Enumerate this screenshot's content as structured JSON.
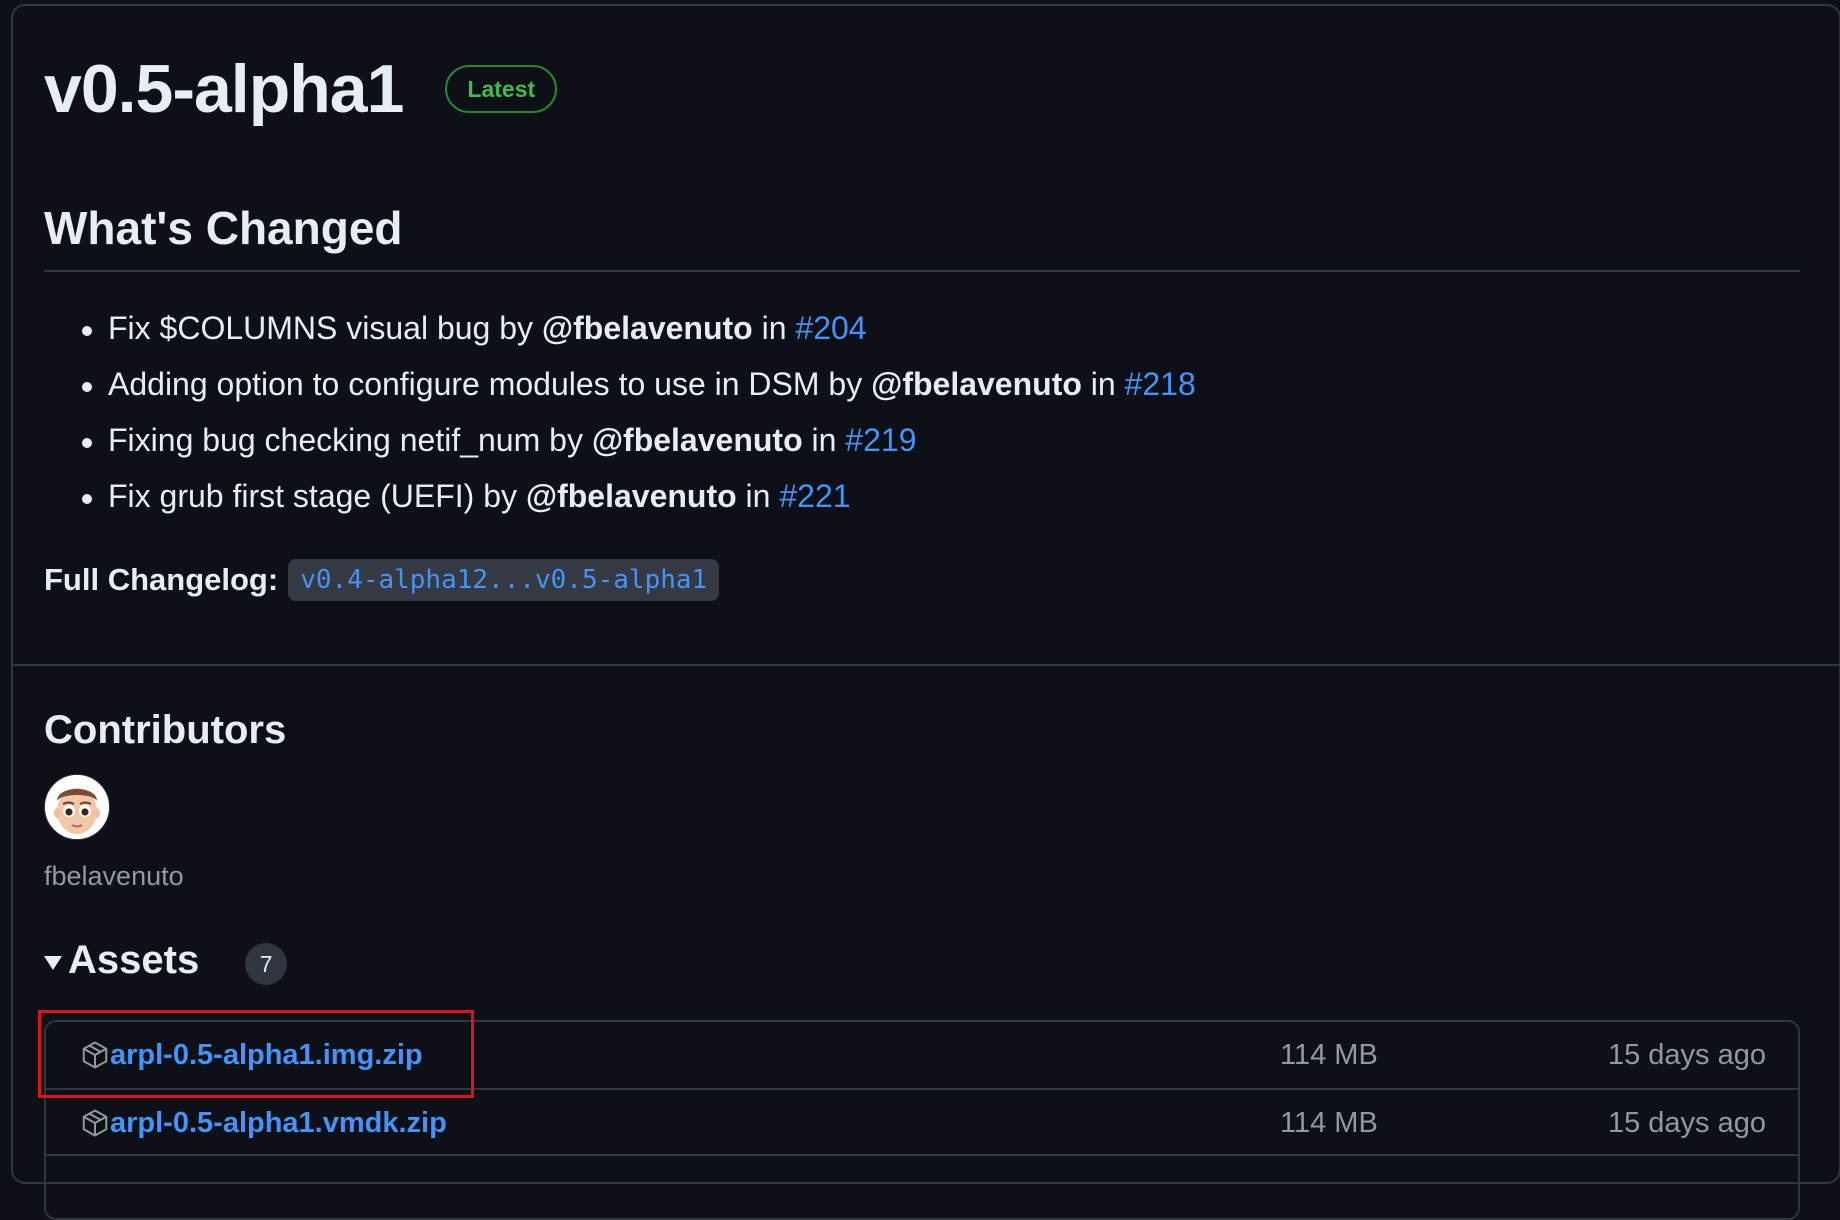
{
  "release": {
    "title": "v0.5-alpha1",
    "badge": "Latest"
  },
  "whats_changed": {
    "heading": "What's Changed",
    "items": [
      {
        "text": "Fix $COLUMNS visual bug by ",
        "author": "@fbelavenuto",
        "in_text": " in ",
        "pr": "#204"
      },
      {
        "text": "Adding option to configure modules to use in DSM by ",
        "author": "@fbelavenuto",
        "in_text": " in ",
        "pr": "#218"
      },
      {
        "text": "Fixing bug checking netif_num by ",
        "author": "@fbelavenuto",
        "in_text": " in ",
        "pr": "#219"
      },
      {
        "text": "Fix grub first stage (UEFI) by ",
        "author": "@fbelavenuto",
        "in_text": " in ",
        "pr": "#221"
      }
    ]
  },
  "full_changelog": {
    "label": "Full Changelog:",
    "range": "v0.4-alpha12...v0.5-alpha1"
  },
  "contributors": {
    "heading": "Contributors",
    "users": [
      {
        "name": "fbelavenuto",
        "avatar_icon": "avatar-face-icon"
      }
    ]
  },
  "assets": {
    "heading": "Assets",
    "count": "7",
    "items": [
      {
        "name": "arpl-0.5-alpha1.img.zip",
        "size": "114 MB",
        "date": "15 days ago",
        "icon": "package-icon"
      },
      {
        "name": "arpl-0.5-alpha1.vmdk.zip",
        "size": "114 MB",
        "date": "15 days ago",
        "icon": "package-icon"
      }
    ]
  },
  "colors": {
    "background": "#0d1117",
    "link": "#4493f8",
    "latest_badge": "#3fb950",
    "highlight": "#e0121a"
  }
}
